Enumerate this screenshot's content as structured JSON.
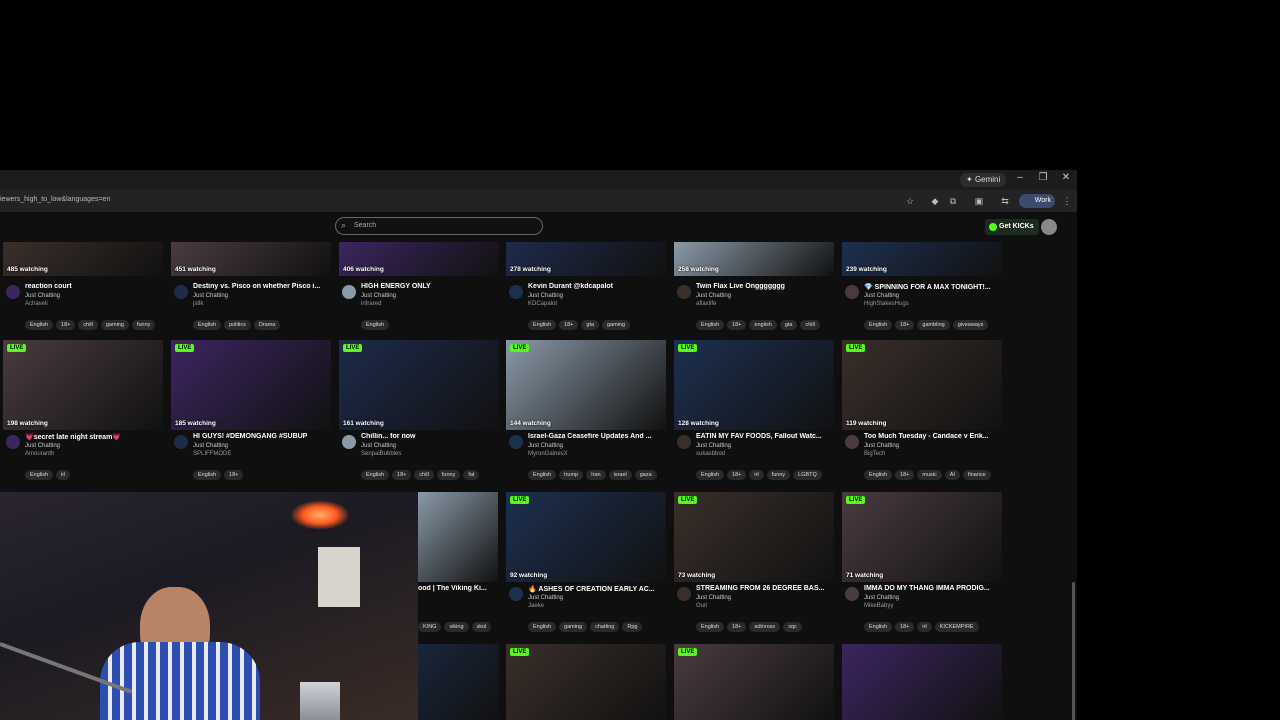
{
  "window": {
    "gemini_label": "Gemini"
  },
  "address": {
    "url_text": "iewers_high_to_low&languages=en",
    "profile_label": "Work"
  },
  "site": {
    "search_placeholder": "Search",
    "get_kicks_label": "Get KICKs"
  },
  "colors": {
    "accent": "#53fc18",
    "background": "#0f0f10"
  },
  "rows": [
    [
      {
        "watching": "485 watching",
        "title": "reaction court",
        "category": "Just Chatting",
        "channel": "Achaveli",
        "tags": [
          "English",
          "18+",
          "chill",
          "gaming",
          "funny"
        ],
        "live": false
      },
      {
        "watching": "451 watching",
        "title": "Destiny vs. Pisco on whether Pisco i...",
        "category": "Just Chatting",
        "channel": "jstlk",
        "tags": [
          "English",
          "politics",
          "Drama"
        ],
        "live": false
      },
      {
        "watching": "406 watching",
        "title": "HIGH ENERGY ONLY",
        "category": "Just Chatting",
        "channel": "infrared",
        "tags": [
          "English"
        ],
        "live": false
      },
      {
        "watching": "278 watching",
        "title": "Kevin Durant @kdcapalot",
        "category": "Just Chatting",
        "channel": "KDCapalot",
        "tags": [
          "English",
          "18+",
          "gta",
          "gaming"
        ],
        "live": false
      },
      {
        "watching": "258 watching",
        "title": "Twin Flax Live Onggggggg",
        "category": "Just Chatting",
        "channel": "aflaxlife",
        "tags": [
          "English",
          "18+",
          "english",
          "gta",
          "chill"
        ],
        "live": false
      },
      {
        "watching": "239 watching",
        "title": "💎 SPINNING FOR A MAX TONIGHT!...",
        "category": "Just Chatting",
        "channel": "HighStakesHugs",
        "tags": [
          "English",
          "18+",
          "gambling",
          "giveaways"
        ],
        "live": false
      }
    ],
    [
      {
        "watching": "198 watching",
        "title": "💗secret late night stream💗",
        "category": "Just Chatting",
        "channel": "Amouranth",
        "tags": [
          "English",
          "irl"
        ],
        "live": true
      },
      {
        "watching": "185 watching",
        "title": "HI GUYS! #DEMONGANG #SUBUP",
        "category": "Just Chatting",
        "channel": "SPLIFFMODE",
        "tags": [
          "English",
          "18+"
        ],
        "live": true
      },
      {
        "watching": "161 watching",
        "title": "Chillin... for now",
        "category": "Just Chatting",
        "channel": "SenpaiBubbles",
        "tags": [
          "English",
          "18+",
          "chill",
          "funny",
          "fat"
        ],
        "live": true
      },
      {
        "watching": "144 watching",
        "title": "Israel-Gaza Ceasefire Updates And ...",
        "category": "Just Chatting",
        "channel": "MyronGainesX",
        "tags": [
          "English",
          "trump",
          "Iran",
          "israel",
          "gaza"
        ],
        "live": true
      },
      {
        "watching": "128 watching",
        "title": "EATIN MY FAV FOODS, Fallout Watc...",
        "category": "Just Chatting",
        "channel": "sukasbbod",
        "tags": [
          "English",
          "18+",
          "irl",
          "funny",
          "LGBTQ"
        ],
        "live": true
      },
      {
        "watching": "119 watching",
        "title": "Too Much Tuesday - Candace v Erik...",
        "category": "Just Chatting",
        "channel": "BigTech",
        "tags": [
          "English",
          "18+",
          "music",
          "AI",
          "finance"
        ],
        "live": true
      }
    ],
    [
      {
        "watching": "",
        "title": "ood | The Viking Ki...",
        "category": "",
        "channel": "",
        "tags": [
          "KING",
          "viking",
          "skol"
        ],
        "live": false
      },
      {
        "watching": "92 watching",
        "title": "🔥 ASHES OF CREATION EARLY AC...",
        "category": "Just Chatting",
        "channel": "Jaeke",
        "tags": [
          "English",
          "gaming",
          "chatting",
          "Rpg"
        ],
        "live": true
      },
      {
        "watching": "73 watching",
        "title": "STREAMING FROM 26 DEGREE BAS...",
        "category": "Just Chatting",
        "channel": "Ouri",
        "tags": [
          "English",
          "18+",
          "adinross",
          "xqc"
        ],
        "live": true
      },
      {
        "watching": "71 watching",
        "title": "IMMA DO MY THANG IMMA PRODIG...",
        "category": "Just Chatting",
        "channel": "MikeBabyy",
        "tags": [
          "English",
          "18+",
          "irl",
          "KICKEMPIRE"
        ],
        "live": true
      }
    ],
    [
      {
        "live": false
      },
      {
        "live": true
      },
      {
        "live": true
      },
      {
        "live": false
      }
    ]
  ]
}
